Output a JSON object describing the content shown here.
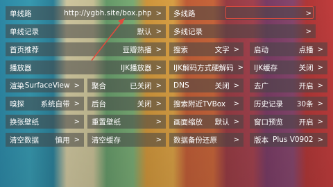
{
  "rows": [
    [
      {
        "label": "单线路",
        "value": "http://ygbh.site/box.php",
        "arrow": ">"
      },
      {
        "label": "多线路",
        "value": "",
        "arrow": ">"
      }
    ],
    [
      {
        "label": "单线记录",
        "value": "默认",
        "arrow": ">"
      },
      {
        "label": "多线记录",
        "value": "",
        "arrow": ">"
      }
    ],
    [
      {
        "label": "首页推荐",
        "value": "豆瓣热播",
        "arrow": ">"
      },
      {
        "label": "搜索",
        "value": "文字",
        "arrow": ">"
      },
      {
        "label": "启动",
        "value": "点播",
        "arrow": ">"
      }
    ],
    [
      {
        "label": "播放器",
        "value": "IJK播放器",
        "arrow": ">"
      },
      {
        "label": "IJK解码方式",
        "value": "硬解码",
        "arrow": ">"
      },
      {
        "label": "IJK缓存",
        "value": "关闭",
        "arrow": ">"
      }
    ],
    [
      {
        "label": "渲染",
        "value": "SurfaceView",
        "arrow": ">"
      },
      {
        "label": "聚合",
        "value": "已关闭",
        "arrow": ">"
      },
      {
        "label": "DNS",
        "value": "关闭",
        "arrow": ">"
      },
      {
        "label": "去广",
        "value": "开启",
        "arrow": ">"
      }
    ],
    [
      {
        "label": "嗅探",
        "value": "系统自带",
        "arrow": ">"
      },
      {
        "label": "后台",
        "value": "关闭",
        "arrow": ">"
      },
      {
        "label": "搜索附近TVBox",
        "value": "",
        "arrow": ">"
      },
      {
        "label": "历史记录",
        "value": "30条",
        "arrow": ">"
      }
    ],
    [
      {
        "label": "换张壁纸",
        "value": "",
        "arrow": ">"
      },
      {
        "label": "重置壁纸",
        "value": "",
        "arrow": ">"
      },
      {
        "label": "画面缩放",
        "value": "默认",
        "arrow": ">"
      },
      {
        "label": "窗口预览",
        "value": "开启",
        "arrow": ">"
      }
    ],
    [
      {
        "label": "清空数据",
        "value": "慎用",
        "arrow": ">"
      },
      {
        "label": "清空缓存",
        "value": "",
        "arrow": ">"
      },
      {
        "label": "数据备份还原",
        "value": "",
        "arrow": ">"
      },
      {
        "label": "版本",
        "value": "Plus V0902",
        "arrow": ">"
      }
    ]
  ],
  "colors": {
    "highlight": "#e24b3d"
  }
}
